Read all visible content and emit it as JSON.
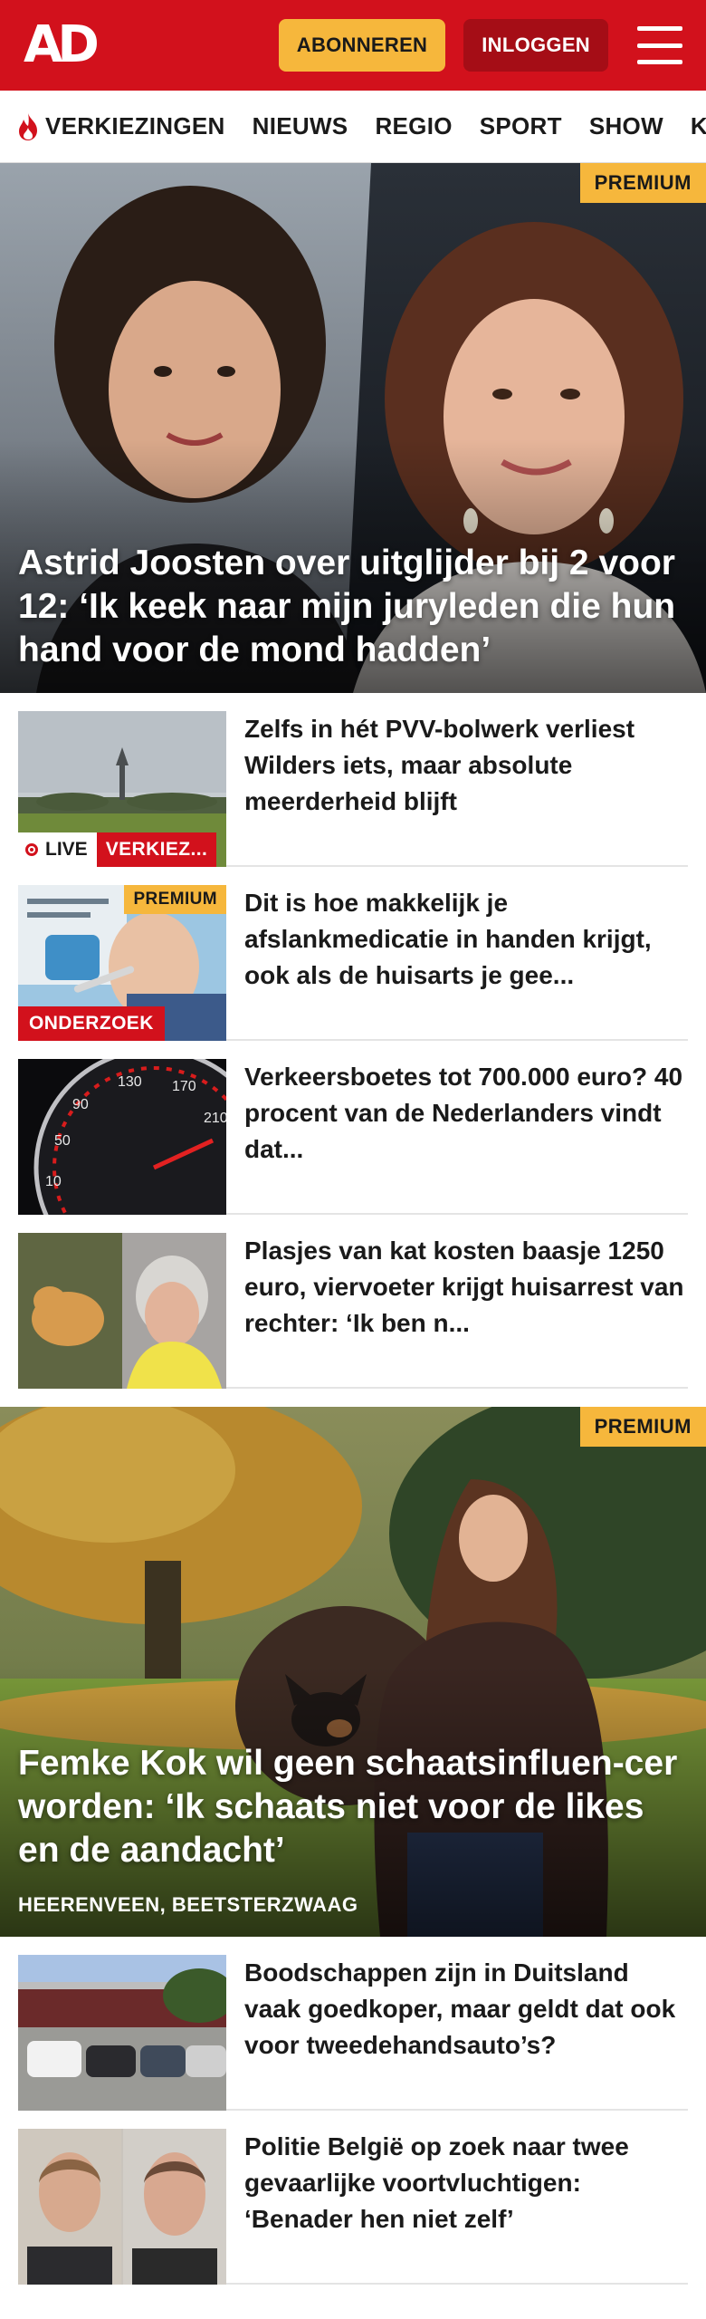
{
  "header": {
    "logo": "AD",
    "subscribe_label": "ABONNEREN",
    "login_label": "INLOGGEN"
  },
  "nav": {
    "items": [
      "VERKIEZINGEN",
      "NIEUWS",
      "REGIO",
      "SPORT",
      "SHOW",
      "KIJK"
    ]
  },
  "hero1": {
    "badge": "PREMIUM",
    "title": "Astrid Joosten over uitglijder bij 2 voor 12: ‘Ik keek naar mijn juryleden die hun hand voor de mond hadden’"
  },
  "articles": [
    {
      "title": "Zelfs in hét PVV-bolwerk verliest Wilders iets, maar absolute meerderheid blijft",
      "live_label": "LIVE",
      "topic_label": "VERKIEZ..."
    },
    {
      "title": "Dit is hoe makkelijk je afslankmedicatie in handen krijgt, ook als de huisarts je gee...",
      "badge": "PREMIUM",
      "label": "ONDERZOEK"
    },
    {
      "title": "Verkeersboetes tot 700.000 euro? 40 procent van de Nederlanders vindt dat..."
    },
    {
      "title": "Plasjes van kat kosten baasje 1250 euro, viervoeter krijgt huisarrest van rechter: ‘Ik ben n..."
    }
  ],
  "hero2": {
    "badge": "PREMIUM",
    "title": "Femke Kok wil geen schaatsinfluen-cer worden: ‘Ik schaats niet voor de likes en de aandacht’",
    "location": "HEERENVEEN, BEETSTERZWAAG"
  },
  "articles2": [
    {
      "title": "Boodschappen zijn in Duitsland vaak goedkoper, maar geldt dat ook voor tweedehandsauto’s?"
    },
    {
      "title": "Politie België op zoek naar twee gevaarlijke voortvluchtigen: ‘Benader hen niet zelf’"
    }
  ],
  "colors": {
    "brand_red": "#d2111c",
    "premium_yellow": "#f6b73c",
    "login_dark_red": "#a50d16"
  }
}
